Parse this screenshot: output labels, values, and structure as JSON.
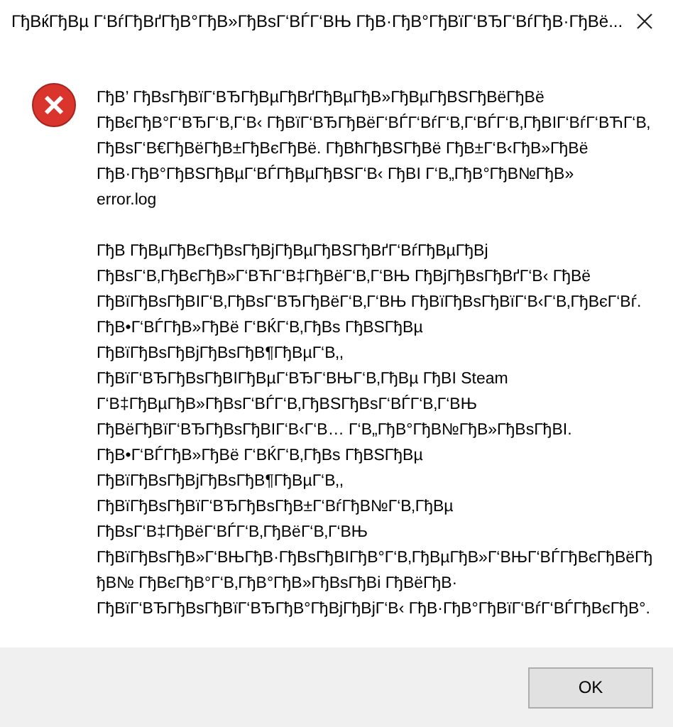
{
  "window": {
    "title": "ГђВќГђВµ Г‘ВѓГђВґГђВ°ГђВ»ГђВѕГ‘ВЃГ‘ВЊ ГђВ·ГђВ°ГђВїГ‘ВЂГ‘ВѓГђВ·ГђВё..."
  },
  "message": {
    "kind": "error",
    "paragraphs": [
      [
        "ГђВ’ ГђВѕГђВїГ‘ВЂГђВµГђВґГђВµГђВ»ГђВµГђВЅГђВёГђВё",
        "ГђВєГђВ°Г‘ВЂГ‘В‚Г‘В‹ ГђВїГ‘ВЂГђВёГ‘ВЃГ‘ВѓГ‘В‚Г‘ВЃГ‘В‚ГђВІГ‘ВѓГ‘ВЋГ‘В‚",
        "ГђВѕГ‘В€ГђВёГђВ±ГђВєГђВё. ГђВћГђВЅГђВё ГђВ±Г‘В‹ГђВ»ГђВё",
        "ГђВ·ГђВ°ГђВЅГђВµГ‘ВЃГђВµГђВЅГ‘В‹ ГђВІ Г‘В„ГђВ°ГђВ№ГђВ»",
        "error.log"
      ],
      [
        "ГђВ ГђВµГђВєГђВѕГђВјГђВµГђВЅГђВґГ‘ВѓГђВµГђВј",
        "ГђВѕГ‘В‚ГђВєГђВ»Г‘ВЋГ‘В‡ГђВёГ‘В‚Г‘ВЊ ГђВјГђВѕГђВґГ‘В‹ ГђВё",
        "ГђВїГђВѕГђВІГ‘В‚ГђВѕГ‘ВЂГђВёГ‘В‚Г‘ВЊ ГђВїГђВѕГђВїГ‘В‹Г‘В‚ГђВєГ‘Вѓ.",
        "ГђВ•Г‘ВЃГђВ»ГђВё Г‘ВЌГ‘В‚ГђВѕ ГђВЅГђВµ",
        "ГђВїГђВѕГђВјГђВѕГђВ¶ГђВµГ‘В‚,",
        "ГђВїГ‘ВЂГђВѕГђВІГђВµГ‘ВЂГ‘ВЊГ‘В‚ГђВµ ГђВІ Steam",
        "Г‘В‡ГђВµГђВ»ГђВѕГ‘ВЃГ‘В‚ГђВЅГђВѕГ‘ВЃГ‘В‚Г‘ВЊ",
        "ГђВёГђВїГ‘ВЂГђВѕГђВІГ‘В‹Г‘В… Г‘В„ГђВ°ГђВ№ГђВ»ГђВѕГђВІ.",
        "ГђВ•Г‘ВЃГђВ»ГђВё Г‘ВЌГ‘В‚ГђВѕ ГђВЅГђВµ",
        "ГђВїГђВѕГђВјГђВѕГђВ¶ГђВµГ‘В‚,",
        "ГђВїГђВѕГђВїГ‘ВЂГђВѕГђВ±Г‘ВѓГђВ№Г‘В‚ГђВµ",
        "ГђВѕГ‘В‡ГђВёГ‘ВЃГ‘В‚ГђВёГ‘В‚Г‘ВЊ",
        "ГђВїГђВѕГђВ»Г‘ВЊГђВ·ГђВѕГђВІГђВ°Г‘В‚ГђВµГђВ»Г‘ВЊГ‘ВЃГђВєГђВёГђ",
        "ђВ№ ГђВєГђВ°Г‘В‚ГђВ°ГђВ»ГђВѕГђВі ГђВёГђВ·",
        "ГђВїГ‘ВЂГђВѕГђВїГ‘ВЂГђВ°ГђВјГђВјГ‘В‹ ГђВ·ГђВ°ГђВїГ‘ВѓГ‘ВЃГђВєГђВ°."
      ]
    ]
  },
  "buttons": [
    "OK"
  ]
}
